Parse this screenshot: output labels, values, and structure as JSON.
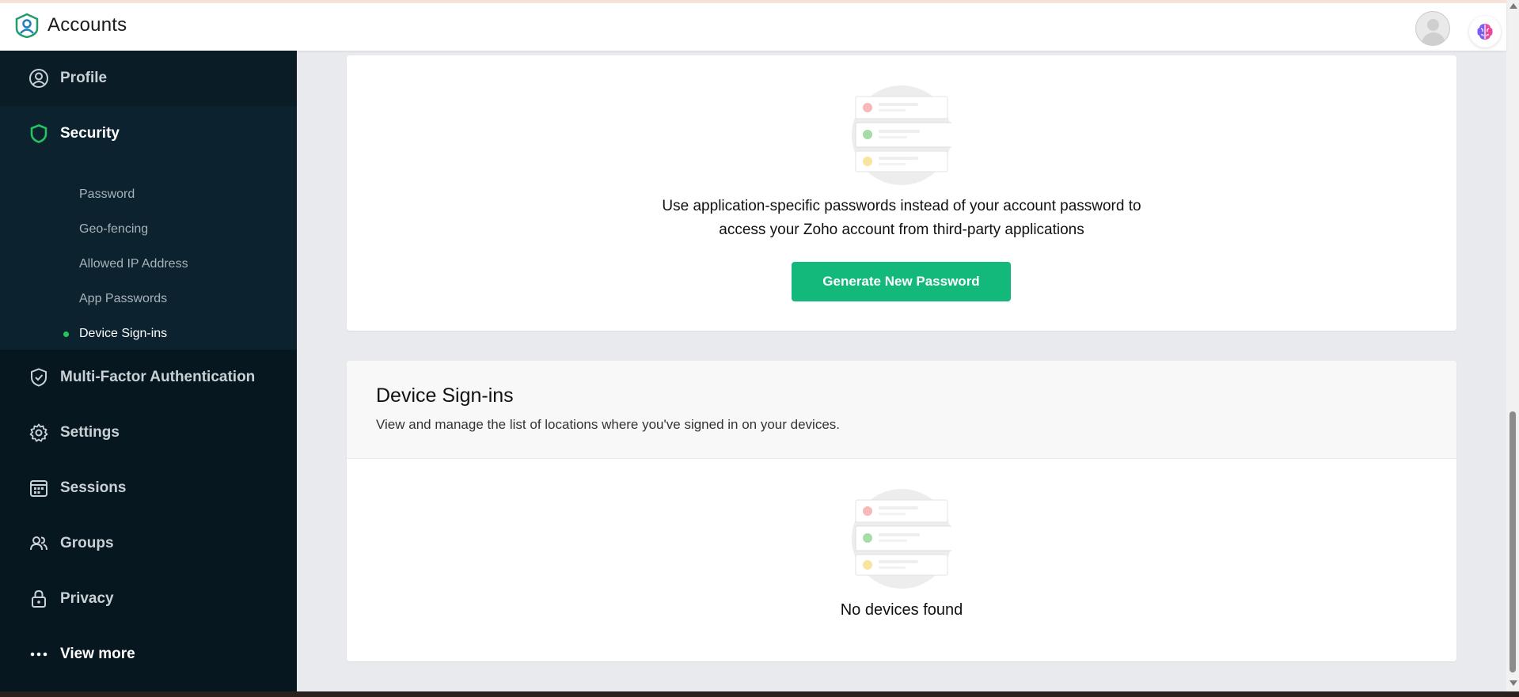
{
  "header": {
    "app_name": "Accounts"
  },
  "sidebar": {
    "items": [
      {
        "label": "Profile",
        "icon": "profile-icon"
      },
      {
        "label": "Security",
        "icon": "shield-icon",
        "active": true
      },
      {
        "label": "Multi-Factor Authentication",
        "icon": "shield-check-icon"
      },
      {
        "label": "Settings",
        "icon": "gear-icon"
      },
      {
        "label": "Sessions",
        "icon": "calendar-icon"
      },
      {
        "label": "Groups",
        "icon": "users-icon"
      },
      {
        "label": "Privacy",
        "icon": "lock-icon"
      },
      {
        "label": "View more",
        "icon": "more-dots-icon"
      }
    ],
    "security_subitems": [
      {
        "label": "Password"
      },
      {
        "label": "Geo-fencing"
      },
      {
        "label": "Allowed IP Address"
      },
      {
        "label": "App Passwords"
      },
      {
        "label": "Device Sign-ins",
        "active": true
      }
    ]
  },
  "app_passwords": {
    "description_line1": "Use application-specific passwords instead of your account password to",
    "description_line2": "access your Zoho account from third-party applications",
    "button_label": "Generate New Password"
  },
  "device_signins": {
    "title": "Device Sign-ins",
    "description": "View and manage the list of locations where you've signed in on your devices.",
    "empty_message": "No devices found"
  },
  "colors": {
    "sidebar_bg": "#07171f",
    "accent_green": "#13b87b",
    "active_dot": "#22c55e"
  }
}
